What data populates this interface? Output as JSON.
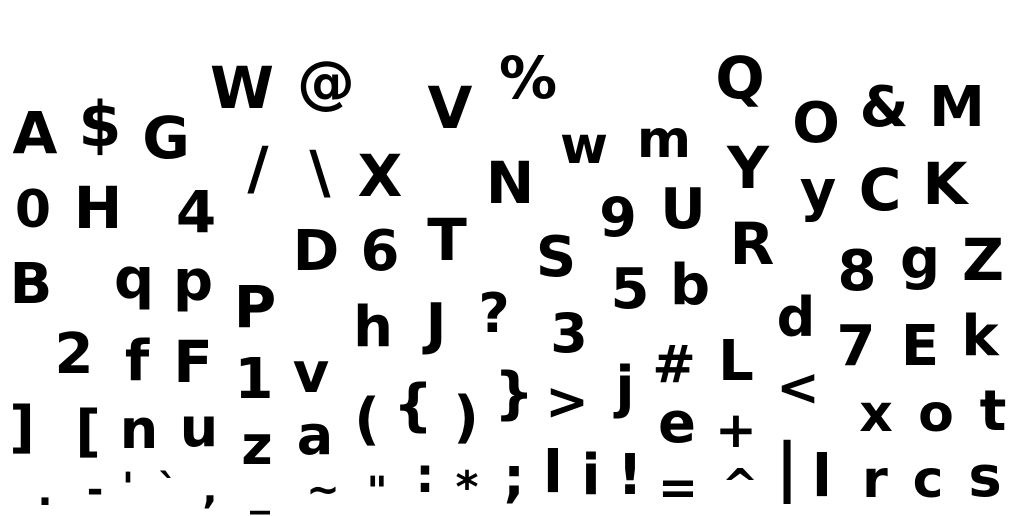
{
  "glyphs": [
    "A",
    "$",
    "G",
    "W",
    "@",
    "V",
    "%",
    "w",
    "m",
    "Q",
    "O",
    "&",
    "M",
    "0",
    "H",
    "4",
    "/",
    "\\",
    "X",
    "N",
    "9",
    "U",
    "Y",
    "y",
    "C",
    "K",
    "B",
    "q",
    "p",
    "D",
    "6",
    "T",
    "S",
    "5",
    "b",
    "R",
    "8",
    "g",
    "Z",
    "P",
    "h",
    "J",
    "?",
    "3",
    "d",
    "2",
    "f",
    "F",
    "1",
    "v",
    "#",
    "L",
    "7",
    "E",
    "k",
    "]",
    "[",
    "n",
    "u",
    "z",
    "a",
    "(",
    "{",
    ")",
    "}",
    ">",
    "j",
    "e",
    "<",
    "+",
    "x",
    "o",
    "t",
    ".",
    "-",
    "'",
    "`",
    ",",
    "_",
    "~",
    "\"",
    ":",
    "*",
    ";",
    "l",
    "i",
    "!",
    "=",
    "^",
    "|",
    "l",
    "r",
    "c",
    "s"
  ],
  "colors": {
    "background": "#ffffff",
    "ink": "#000000"
  }
}
